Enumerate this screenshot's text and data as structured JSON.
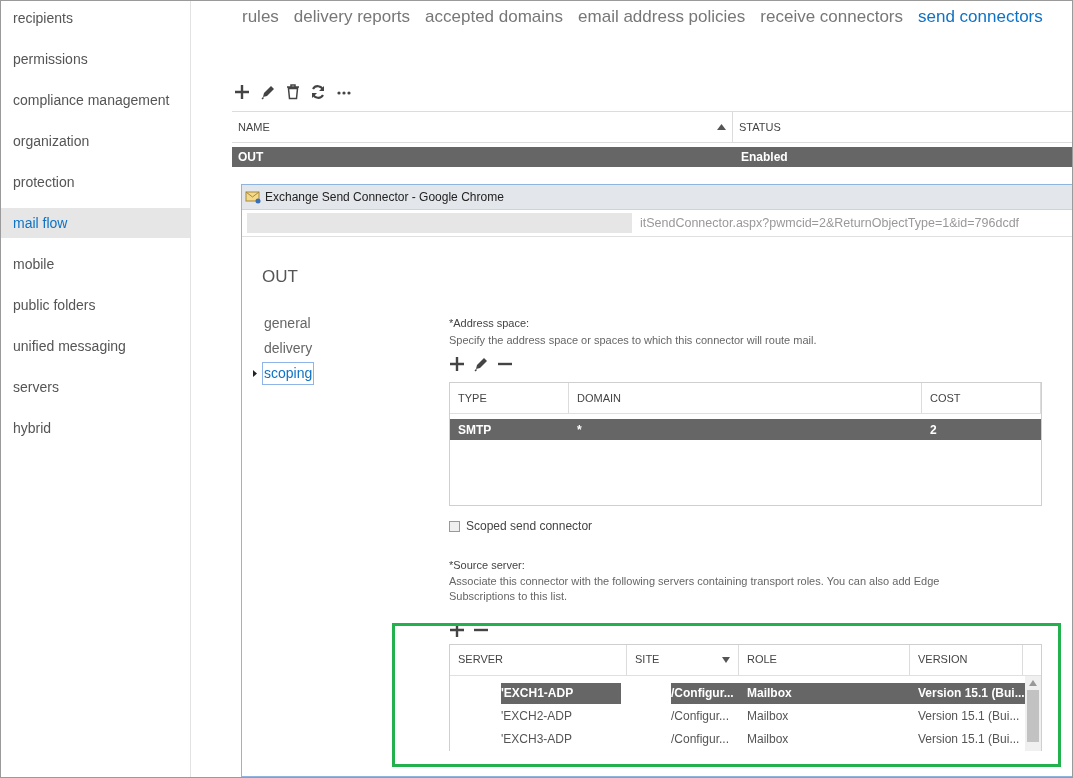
{
  "sidebar": {
    "items": [
      {
        "label": "recipients",
        "selected": false
      },
      {
        "label": "permissions",
        "selected": false
      },
      {
        "label": "compliance management",
        "selected": false
      },
      {
        "label": "organization",
        "selected": false
      },
      {
        "label": "protection",
        "selected": false
      },
      {
        "label": "mail flow",
        "selected": true
      },
      {
        "label": "mobile",
        "selected": false
      },
      {
        "label": "public folders",
        "selected": false
      },
      {
        "label": "unified messaging",
        "selected": false
      },
      {
        "label": "servers",
        "selected": false
      },
      {
        "label": "hybrid",
        "selected": false
      }
    ]
  },
  "tabs": [
    {
      "label": "rules",
      "selected": false
    },
    {
      "label": "delivery reports",
      "selected": false
    },
    {
      "label": "accepted domains",
      "selected": false
    },
    {
      "label": "email address policies",
      "selected": false
    },
    {
      "label": "receive connectors",
      "selected": false
    },
    {
      "label": "send connectors",
      "selected": true
    }
  ],
  "connectors_table": {
    "columns": [
      {
        "label": "NAME",
        "sorted": true
      },
      {
        "label": "STATUS"
      }
    ],
    "rows": [
      {
        "name": "OUT",
        "status": "Enabled",
        "selected": true
      }
    ]
  },
  "popup": {
    "title": "Exchange Send Connector - Google Chrome",
    "url": "itSendConnector.aspx?pwmcid=2&ReturnObjectType=1&id=796dcdf",
    "heading": "OUT",
    "nav": [
      {
        "label": "general",
        "selected": false
      },
      {
        "label": "delivery",
        "selected": false
      },
      {
        "label": "scoping",
        "selected": true
      }
    ],
    "address_space": {
      "label": "*Address space:",
      "description": "Specify the address space or spaces to which this connector will route mail.",
      "columns": [
        "TYPE",
        "DOMAIN",
        "COST"
      ],
      "rows": [
        {
          "type": "SMTP",
          "domain": "*",
          "cost": "2",
          "selected": true
        }
      ]
    },
    "scoped_checkbox": {
      "label": "Scoped send connector",
      "checked": false
    },
    "source_server": {
      "label": "*Source server:",
      "description": "Associate this connector with the following servers containing transport roles. You can also add Edge Subscriptions to this list.",
      "columns": [
        {
          "label": "SERVER"
        },
        {
          "label": "SITE",
          "filter": true
        },
        {
          "label": "ROLE"
        },
        {
          "label": "VERSION"
        }
      ],
      "rows": [
        {
          "server": "'EXCH1-ADP",
          "site": "/Configur...",
          "role": "Mailbox",
          "version": "Version 15.1 (Bui...",
          "selected": true
        },
        {
          "server": "'EXCH2-ADP",
          "site": "/Configur...",
          "role": "Mailbox",
          "version": "Version 15.1 (Bui...",
          "selected": false
        },
        {
          "server": "'EXCH3-ADP",
          "site": "/Configur...",
          "role": "Mailbox",
          "version": "Version 15.1 (Bui...",
          "selected": false
        }
      ]
    }
  }
}
